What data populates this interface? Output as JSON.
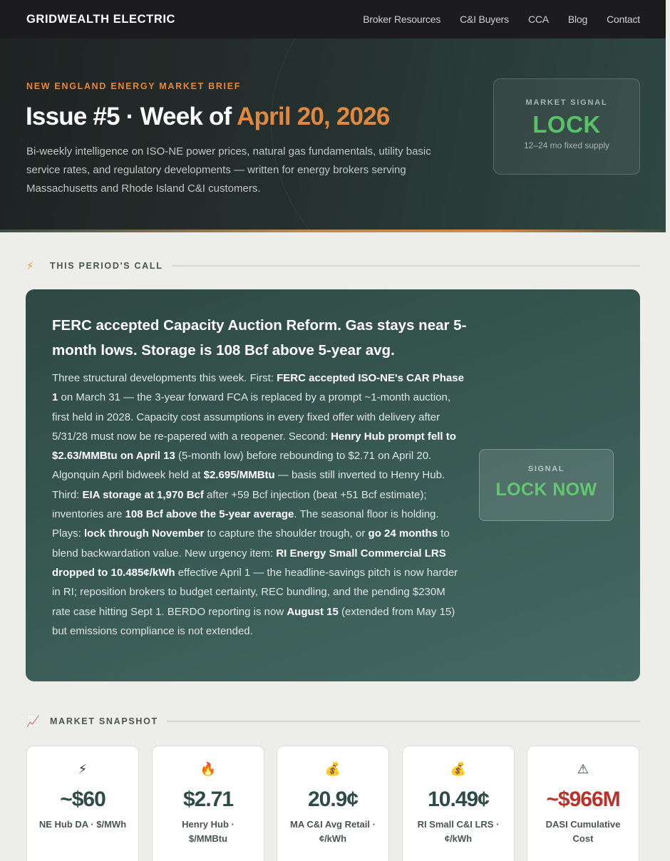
{
  "nav": {
    "brand": "GRIDWEALTH ELECTRIC",
    "links": [
      "Broker Resources",
      "C&I Buyers",
      "CCA",
      "Blog",
      "Contact"
    ]
  },
  "hero": {
    "eyebrow": "NEW ENGLAND ENERGY MARKET BRIEF",
    "title_prefix": "Issue #5 · Week of ",
    "title_date": "April 20, 2026",
    "description": "Bi-weekly intelligence on ISO-NE power prices, natural gas fundamentals, utility basic service rates, and regulatory developments — written for energy brokers serving Massachusetts and Rhode Island C&I customers.",
    "signal": {
      "label": "MARKET SIGNAL",
      "value": "LOCK",
      "sub": "12–24 mo fixed supply",
      "color": "#57c26a"
    }
  },
  "call_section": {
    "heading": "THIS PERIOD'S CALL",
    "icon": "lightning-icon",
    "title": "FERC accepted Capacity Auction Reform. Gas stays near 5-month lows. Storage is 108 Bcf above 5-year avg.",
    "body_segments": [
      {
        "t": "Three structural developments this week. First: ",
        "b": false
      },
      {
        "t": "FERC accepted ISO-NE's CAR Phase 1",
        "b": true
      },
      {
        "t": " on March 31 — the 3-year forward FCA is replaced by a prompt ~1-month auction, first held in 2028. Capacity cost assumptions in every fixed offer with delivery after 5/31/28 must now be re-papered with a reopener. Second: ",
        "b": false
      },
      {
        "t": "Henry Hub prompt fell to $2.63/MMBtu on April 13",
        "b": true
      },
      {
        "t": " (5-month low) before rebounding to $2.71 on April 20. Algonquin April bidweek held at ",
        "b": false
      },
      {
        "t": "$2.695/MMBtu",
        "b": true
      },
      {
        "t": " — basis still inverted to Henry Hub. Third: ",
        "b": false
      },
      {
        "t": "EIA storage at 1,970 Bcf",
        "b": true
      },
      {
        "t": " after +59 Bcf injection (beat +51 Bcf estimate); inventories are ",
        "b": false
      },
      {
        "t": "108 Bcf above the 5-year average",
        "b": true
      },
      {
        "t": ". The seasonal floor is holding. Plays: ",
        "b": false
      },
      {
        "t": "lock through November",
        "b": true
      },
      {
        "t": " to capture the shoulder trough, or ",
        "b": false
      },
      {
        "t": "go 24 months",
        "b": true
      },
      {
        "t": " to blend backwardation value. New urgency item: ",
        "b": false
      },
      {
        "t": "RI Energy Small Commercial LRS dropped to 10.485¢/kWh",
        "b": true
      },
      {
        "t": " effective April 1 — the headline-savings pitch is now harder in RI; reposition brokers to budget certainty, REC bundling, and the pending $230M rate case hitting Sept 1. BERDO reporting is now ",
        "b": false
      },
      {
        "t": "August 15",
        "b": true
      },
      {
        "t": " (extended from May 15) but emissions compliance is not extended.",
        "b": false
      }
    ],
    "signal": {
      "label": "SIGNAL",
      "value": "LOCK NOW"
    }
  },
  "snapshot": {
    "heading": "MARKET SNAPSHOT",
    "icon": "chart-increasing-icon",
    "kpis": [
      {
        "icon": "⚡",
        "icon_name": "lightning-icon",
        "value": "~$60",
        "label": "NE Hub DA · $/MWh",
        "alert": false
      },
      {
        "icon": "🔥",
        "icon_name": "fire-icon",
        "value": "$2.71",
        "label": "Henry Hub · $/MMBtu",
        "alert": false
      },
      {
        "icon": "💰",
        "icon_name": "money-bag-icon",
        "value": "20.9¢",
        "label": "MA C&I Avg Retail · ¢/kWh",
        "alert": false
      },
      {
        "icon": "💰",
        "icon_name": "money-bag-icon",
        "value": "10.49¢",
        "label": "RI Small C&I LRS · ¢/kWh",
        "alert": false
      },
      {
        "icon": "⚠",
        "icon_name": "warning-icon",
        "value": "~$966M",
        "label": "DASI Cumulative Cost",
        "alert": true
      }
    ]
  }
}
